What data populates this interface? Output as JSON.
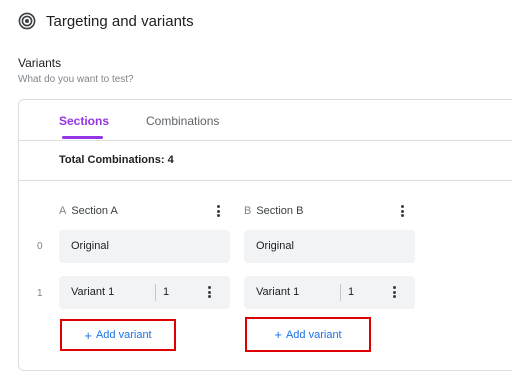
{
  "header": {
    "title": "Targeting and variants",
    "icon": "target-icon"
  },
  "variants": {
    "title": "Variants",
    "subtitle": "What do you want to test?"
  },
  "tabs": [
    {
      "label": "Sections",
      "active": true
    },
    {
      "label": "Combinations",
      "active": false
    }
  ],
  "total_combinations": "Total Combinations: 4",
  "sections": [
    {
      "letter": "A",
      "name": "Section A",
      "rows": [
        {
          "index": "0",
          "label": "Original"
        },
        {
          "index": "1",
          "label": "Variant 1",
          "weight": "1"
        }
      ],
      "add_label": "Add variant"
    },
    {
      "letter": "B",
      "name": "Section B",
      "rows": [
        {
          "label": "Original"
        },
        {
          "label": "Variant 1",
          "weight": "1"
        }
      ],
      "add_label": "Add variant"
    }
  ],
  "colors": {
    "accent": "#9334e6",
    "link": "#1a73e8",
    "highlight": "#e00000"
  }
}
